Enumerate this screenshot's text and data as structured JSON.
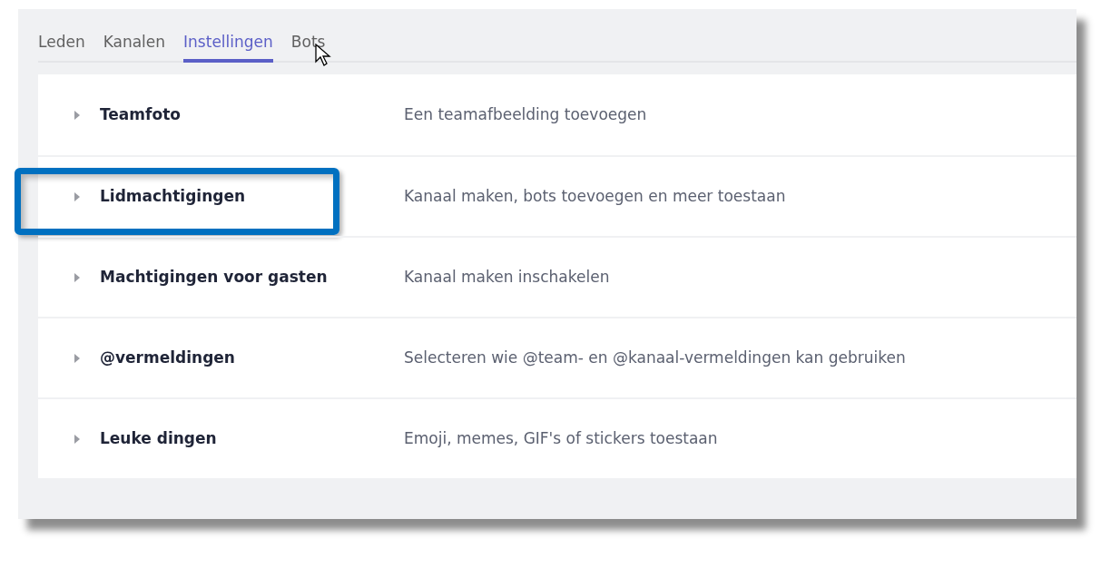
{
  "tabs": [
    {
      "label": "Leden",
      "selected": false
    },
    {
      "label": "Kanalen",
      "selected": false
    },
    {
      "label": "Instellingen",
      "selected": true
    },
    {
      "label": "Bots",
      "selected": false
    }
  ],
  "settings": [
    {
      "title": "Teamfoto",
      "description": "Een teamafbeelding toevoegen",
      "highlighted": false
    },
    {
      "title": "Lidmachtigingen",
      "description": "Kanaal maken, bots toevoegen en meer toestaan",
      "highlighted": true
    },
    {
      "title": "Machtigingen voor gasten",
      "description": "Kanaal maken inschakelen",
      "highlighted": false
    },
    {
      "title": "@vermeldingen",
      "description": "Selecteren wie @team- en @kanaal-vermeldingen kan gebruiken",
      "highlighted": false
    },
    {
      "title": "Leuke dingen",
      "description": "Emoji, memes, GIF's of stickers toestaan",
      "highlighted": false
    }
  ]
}
